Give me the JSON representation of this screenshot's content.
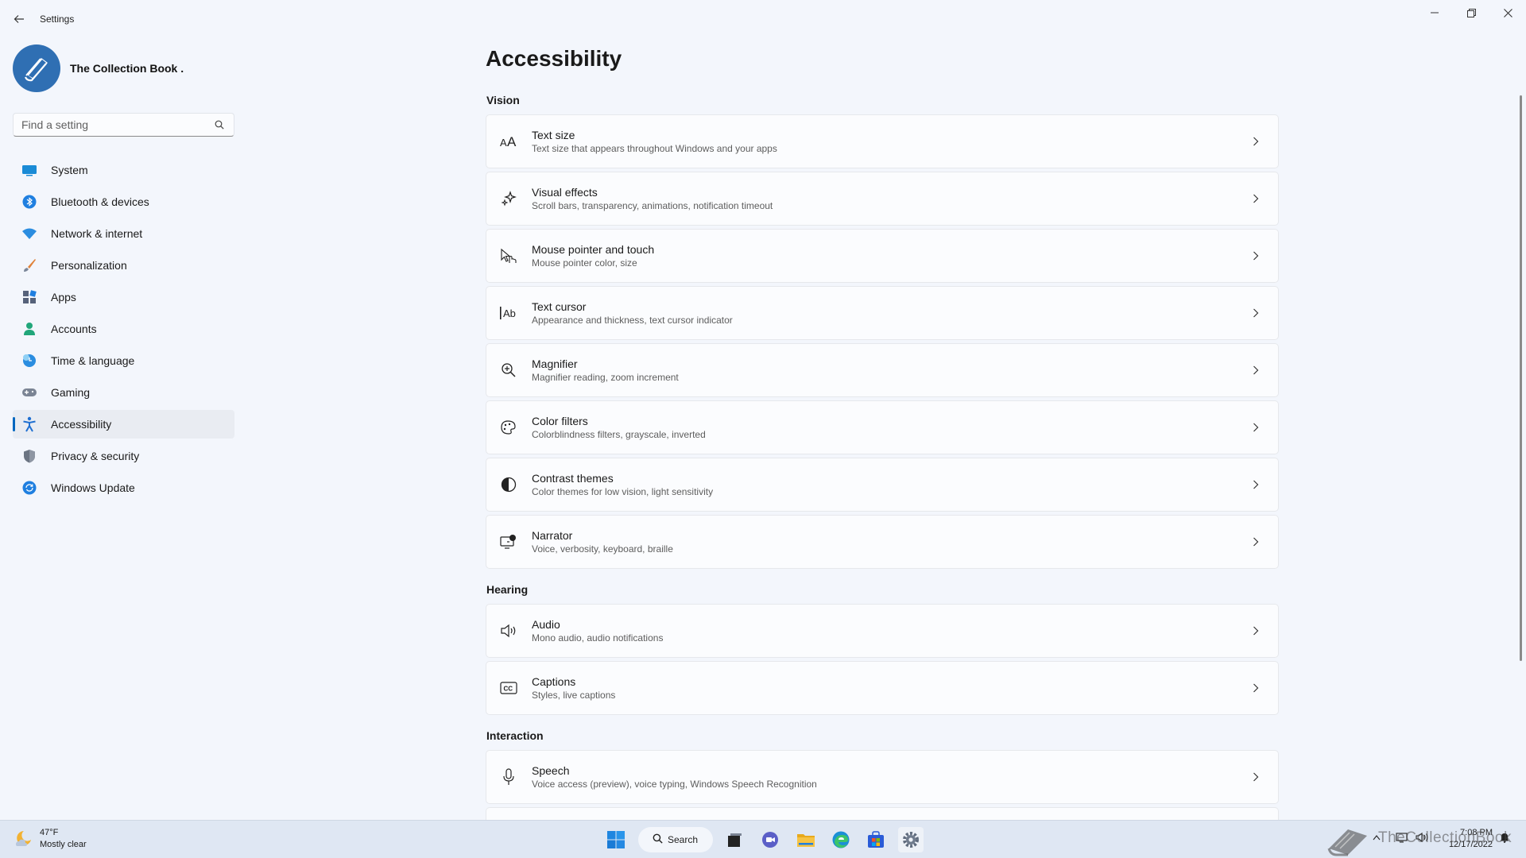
{
  "window": {
    "title": "Settings",
    "back_icon": "back-arrow-icon",
    "controls": [
      "minimize-icon",
      "maximize-icon",
      "close-icon"
    ]
  },
  "profile": {
    "name": "The Collection Book ."
  },
  "search": {
    "placeholder": "Find a setting"
  },
  "nav": {
    "items": [
      {
        "label": "System",
        "icon": "system-icon",
        "color": "#1a8bd6"
      },
      {
        "label": "Bluetooth & devices",
        "icon": "bluetooth-icon",
        "color": "#1f7fe0"
      },
      {
        "label": "Network & internet",
        "icon": "wifi-icon",
        "color": "#2b8de0"
      },
      {
        "label": "Personalization",
        "icon": "brush-icon",
        "color": "#e0823a"
      },
      {
        "label": "Apps",
        "icon": "apps-icon",
        "color": "#56627a"
      },
      {
        "label": "Accounts",
        "icon": "accounts-icon",
        "color": "#21a67a"
      },
      {
        "label": "Time & language",
        "icon": "time-language-icon",
        "color": "#2b8de0"
      },
      {
        "label": "Gaming",
        "icon": "gaming-icon",
        "color": "#7b8494"
      },
      {
        "label": "Accessibility",
        "icon": "accessibility-icon",
        "color": "#1f6fd1",
        "active": true
      },
      {
        "label": "Privacy & security",
        "icon": "shield-icon",
        "color": "#6b7482"
      },
      {
        "label": "Windows Update",
        "icon": "update-icon",
        "color": "#1f7fe0"
      }
    ]
  },
  "page": {
    "title": "Accessibility"
  },
  "sections": {
    "vision": "Vision",
    "hearing": "Hearing",
    "interaction": "Interaction"
  },
  "cards": [
    {
      "title": "Text size",
      "subtitle": "Text size that appears throughout Windows and your apps",
      "icon": "text-size-icon"
    },
    {
      "title": "Visual effects",
      "subtitle": "Scroll bars, transparency, animations, notification timeout",
      "icon": "visual-effects-icon"
    },
    {
      "title": "Mouse pointer and touch",
      "subtitle": "Mouse pointer color, size",
      "icon": "mouse-pointer-icon"
    },
    {
      "title": "Text cursor",
      "subtitle": "Appearance and thickness, text cursor indicator",
      "icon": "text-cursor-icon"
    },
    {
      "title": "Magnifier",
      "subtitle": "Magnifier reading, zoom increment",
      "icon": "magnifier-icon"
    },
    {
      "title": "Color filters",
      "subtitle": "Colorblindness filters, grayscale, inverted",
      "icon": "color-filters-icon"
    },
    {
      "title": "Contrast themes",
      "subtitle": "Color themes for low vision, light sensitivity",
      "icon": "contrast-icon"
    },
    {
      "title": "Narrator",
      "subtitle": "Voice, verbosity, keyboard, braille",
      "icon": "narrator-icon"
    },
    {
      "title": "Audio",
      "subtitle": "Mono audio, audio notifications",
      "icon": "audio-icon"
    },
    {
      "title": "Captions",
      "subtitle": "Styles, live captions",
      "icon": "captions-icon"
    },
    {
      "title": "Speech",
      "subtitle": "Voice access (preview), voice typing, Windows Speech Recognition",
      "icon": "microphone-icon"
    }
  ],
  "taskbar": {
    "weather_temp": "47°F",
    "weather_desc": "Mostly clear",
    "search_label": "Search",
    "apps": [
      "start-icon",
      "search-icon",
      "task-view-icon",
      "chat-icon",
      "file-explorer-icon",
      "edge-icon",
      "store-icon",
      "settings-icon"
    ],
    "time": "7:08 PM",
    "date": "12/17/2022",
    "watermark": "TheCollectionBook"
  },
  "colors": {
    "accent": "#0067c0",
    "background": "#f3f6fc",
    "card": "#fbfcfe"
  }
}
